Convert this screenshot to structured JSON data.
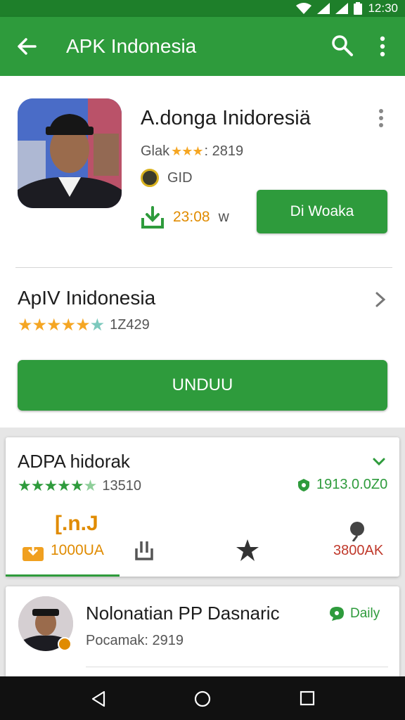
{
  "status_bar": {
    "time": "12:30"
  },
  "app_bar": {
    "title": "APK Indonesia"
  },
  "app_card": {
    "name": "A.donga Inidoresiä",
    "rating_label": "Glak",
    "rating_stars": "★★★",
    "rating_value": ": 2819",
    "developer": "GID",
    "size": "23:08",
    "size_suffix": "w",
    "download_label": "Di Woaka"
  },
  "section": {
    "title": "ApIV Inidonesia",
    "stars": "★★★★★",
    "stars_half": "★",
    "rating_count": "1Z429",
    "download_button": "UNDUU"
  },
  "app_entry": {
    "title": "ADPA hidorak",
    "stars": "★★★★★",
    "stars_half": "★",
    "rating_count": "13510",
    "version": "1913.0.0Z0",
    "gift_label": "[.n.J",
    "download_size": "1000UA",
    "red_value": "3800AK"
  },
  "user_entry": {
    "title": "Nolonatian PP Dasnaric",
    "subtitle": "Pocamak: 2919",
    "badge": "Daily"
  },
  "colors": {
    "primary": "#2e9b3c",
    "primary_dark": "#1e7f2a",
    "accent_orange": "#e08b00",
    "star_yellow": "#f5a623"
  },
  "icons": [
    "back-arrow-icon",
    "search-icon",
    "more-vert-icon",
    "download-icon",
    "chevron-right-icon",
    "chevron-down-icon",
    "share-icon",
    "star-icon",
    "nav-back-icon",
    "nav-home-icon",
    "nav-recent-icon"
  ]
}
